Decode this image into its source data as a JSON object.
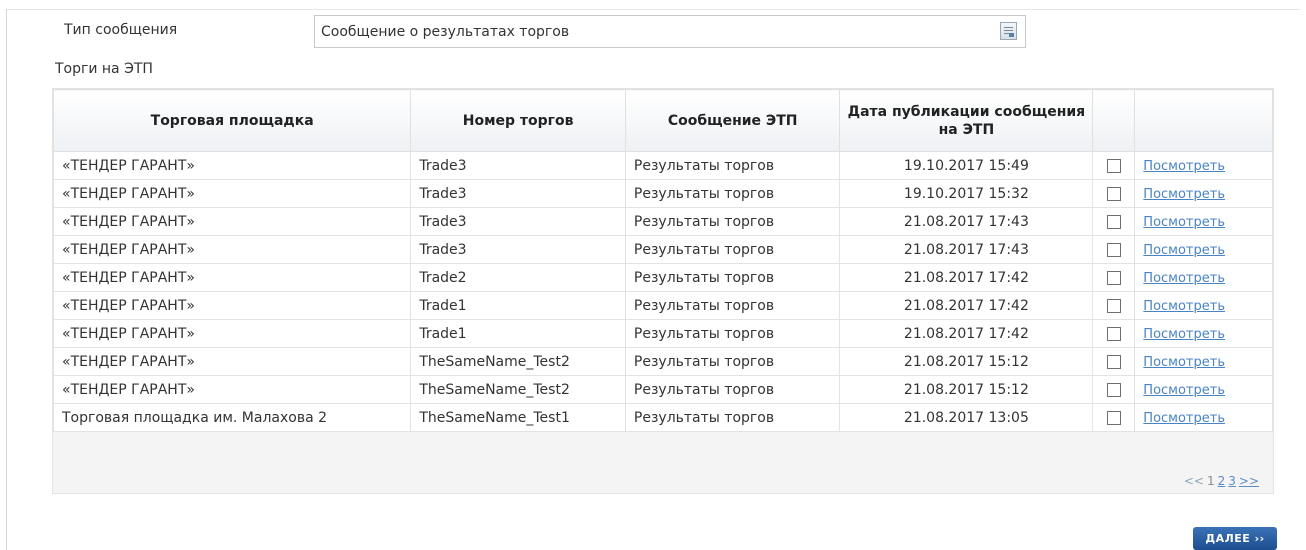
{
  "form": {
    "message_type_label": "Тип сообщения",
    "message_type_value": "Сообщение о результатах торгов",
    "trades_label": "Торги на ЭТП"
  },
  "table": {
    "headers": [
      "Торговая площадка",
      "Номер торгов",
      "Сообщение ЭТП",
      "Дата публикации сообщения на ЭТП",
      "",
      ""
    ],
    "rows": [
      {
        "platform": "«ТЕНДЕР ГАРАНТ»",
        "number": "Trade3",
        "message": "Результаты торгов",
        "date": "19.10.2017 15:49",
        "link": "Посмотреть"
      },
      {
        "platform": "«ТЕНДЕР ГАРАНТ»",
        "number": "Trade3",
        "message": "Результаты торгов",
        "date": "19.10.2017 15:32",
        "link": "Посмотреть"
      },
      {
        "platform": "«ТЕНДЕР ГАРАНТ»",
        "number": "Trade3",
        "message": "Результаты торгов",
        "date": "21.08.2017 17:43",
        "link": "Посмотреть"
      },
      {
        "platform": "«ТЕНДЕР ГАРАНТ»",
        "number": "Trade3",
        "message": "Результаты торгов",
        "date": "21.08.2017 17:43",
        "link": "Посмотреть"
      },
      {
        "platform": "«ТЕНДЕР ГАРАНТ»",
        "number": "Trade2",
        "message": "Результаты торгов",
        "date": "21.08.2017 17:42",
        "link": "Посмотреть"
      },
      {
        "platform": "«ТЕНДЕР ГАРАНТ»",
        "number": "Trade1",
        "message": "Результаты торгов",
        "date": "21.08.2017 17:42",
        "link": "Посмотреть"
      },
      {
        "platform": "«ТЕНДЕР ГАРАНТ»",
        "number": "Trade1",
        "message": "Результаты торгов",
        "date": "21.08.2017 17:42",
        "link": "Посмотреть"
      },
      {
        "platform": "«ТЕНДЕР ГАРАНТ»",
        "number": "TheSameName_Test2",
        "message": "Результаты торгов",
        "date": "21.08.2017 15:12",
        "link": "Посмотреть"
      },
      {
        "platform": "«ТЕНДЕР ГАРАНТ»",
        "number": "TheSameName_Test2",
        "message": "Результаты торгов",
        "date": "21.08.2017 15:12",
        "link": "Посмотреть"
      },
      {
        "platform": "Торговая площадка им. Малахова 2",
        "number": "TheSameName_Test1",
        "message": "Результаты торгов",
        "date": "21.08.2017 13:05",
        "link": "Посмотреть"
      }
    ]
  },
  "pager": {
    "prev": "<<",
    "pages": [
      "1",
      "2",
      "3"
    ],
    "next": ">>"
  },
  "actions": {
    "next_label": "ДАЛЕЕ ›› "
  },
  "colors": {
    "link": "#4a83c4",
    "button": "#1d4e8f",
    "header_bg": "#eef1f4"
  }
}
